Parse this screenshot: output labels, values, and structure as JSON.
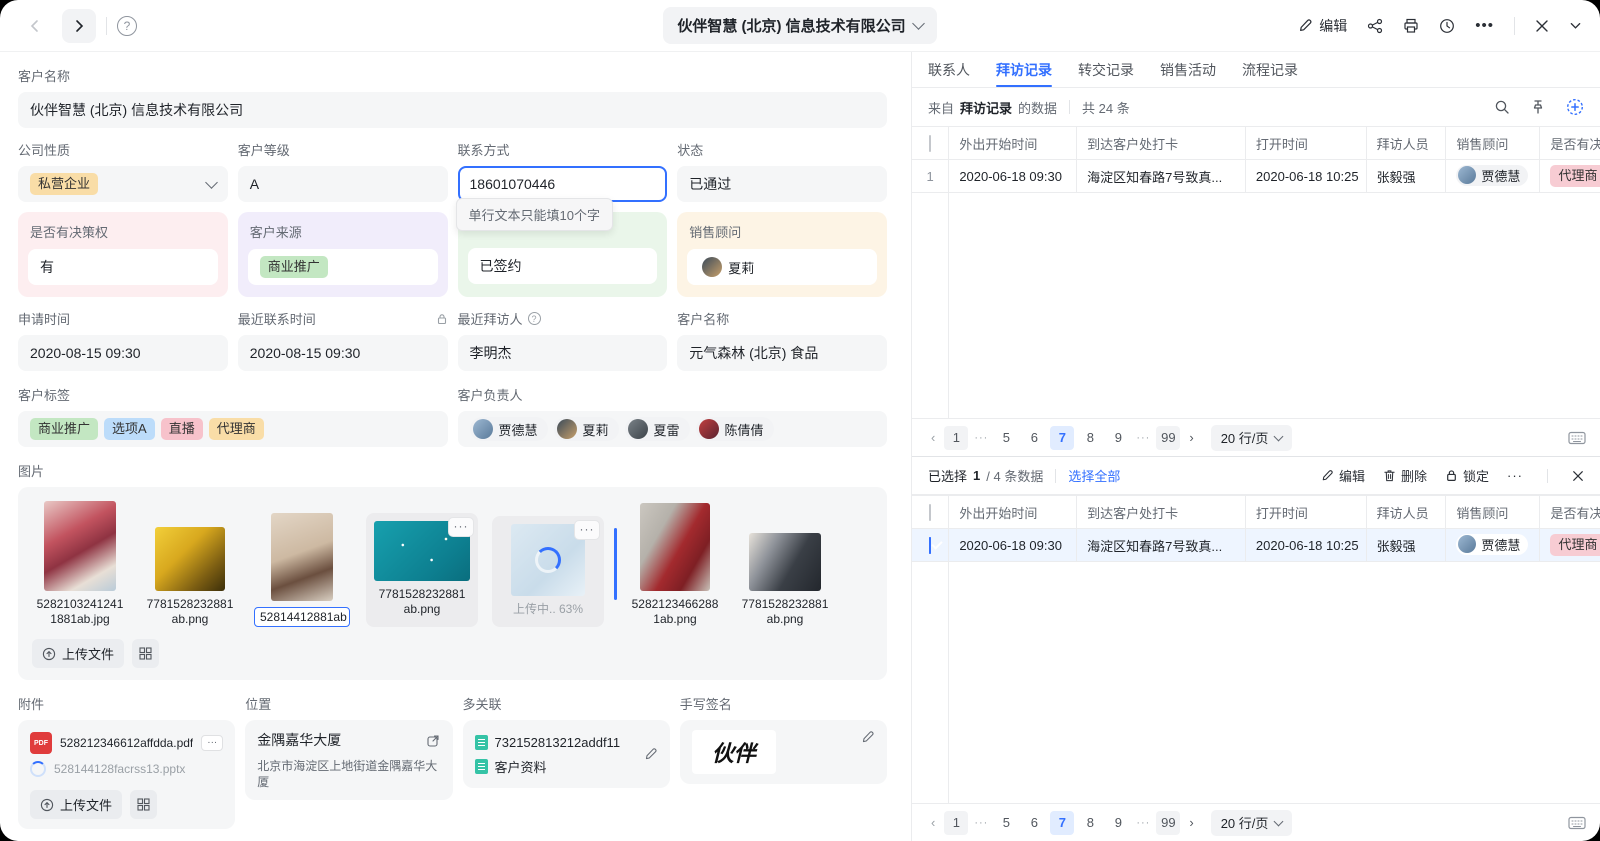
{
  "topbar": {
    "title": "伙伴智慧 (北京) 信息技术有限公司",
    "edit_label": "编辑"
  },
  "form": {
    "customer_name": {
      "label": "客户名称",
      "value": "伙伴智慧 (北京) 信息技术有限公司"
    },
    "company_type": {
      "label": "公司性质",
      "tag": "私营企业"
    },
    "customer_level": {
      "label": "客户等级",
      "value": "A"
    },
    "contact": {
      "label": "联系方式",
      "value": "18601070446",
      "tooltip": "单行文本只能填10个字"
    },
    "status": {
      "label": "状态",
      "value": "已通过"
    },
    "decision": {
      "label": "是否有决策权",
      "value": "有"
    },
    "source": {
      "label": "客户来源",
      "tag": "商业推广"
    },
    "sign_status": {
      "value": "已签约"
    },
    "sales_advisor": {
      "label": "销售顾问",
      "person": "夏莉"
    },
    "apply_time": {
      "label": "申请时间",
      "value": "2020-08-15 09:30"
    },
    "last_contact_time": {
      "label": "最近联系时间",
      "value": "2020-08-15 09:30"
    },
    "last_visitor": {
      "label": "最近拜访人",
      "value": "李明杰",
      "info": "?"
    },
    "customer_name2": {
      "label": "客户名称",
      "value": "元气森林 (北京) 食品"
    },
    "tags": {
      "label": "客户标签",
      "items": [
        "商业推广",
        "选项A",
        "直播",
        "代理商"
      ]
    },
    "owners": {
      "label": "客户负责人",
      "people": [
        "贾德慧",
        "夏莉",
        "夏雷",
        "陈倩倩"
      ]
    }
  },
  "images": {
    "label": "图片",
    "items": [
      {
        "caption1": "5282103241241",
        "caption2": "1881ab.jpg"
      },
      {
        "caption1": "7781528232881",
        "caption2": "ab.png"
      },
      {
        "rename_value": "52814412881ab"
      },
      {
        "caption1": "7781528232881",
        "caption2": "ab.png",
        "menu": "···"
      },
      {
        "status": "上传中.. 63%",
        "menu": "···"
      },
      {
        "caption1": "5282123466288",
        "caption2": "1ab.png"
      },
      {
        "caption1": "7781528232881",
        "caption2": "ab.png"
      }
    ],
    "upload_label": "上传文件"
  },
  "attachments": {
    "label": "附件",
    "files": [
      {
        "name": "528212346612affdda.pdf",
        "badge": "PDF",
        "menu": "···"
      },
      {
        "name": "528144128facrss13.pptx"
      }
    ],
    "upload_label": "上传文件"
  },
  "location": {
    "label": "位置",
    "name": "金隅嘉华大厦",
    "address": "北京市海淀区上地街道金隅嘉华大厦"
  },
  "relations": {
    "label": "多关联",
    "items": [
      "732152813212addf11",
      "客户资料"
    ]
  },
  "signature": {
    "label": "手写签名",
    "value": "伙伴"
  },
  "right": {
    "tabs": [
      "联系人",
      "拜访记录",
      "转交记录",
      "销售活动",
      "流程记录"
    ],
    "info": {
      "prefix": "来自",
      "source": "拜访记录",
      "suffix": "的数据",
      "count": "共 24 条"
    },
    "columns": [
      "外出开始时间",
      "到达客户处打卡",
      "打开时间",
      "拜访人员",
      "销售顾问",
      "是否有决策权"
    ],
    "row": {
      "num": "1",
      "start_time": "2020-06-18 09:30",
      "checkin": "海淀区知春路7号致真...",
      "open_time": "2020-06-18 10:25",
      "visitor": "张毅强",
      "advisor": "贾德慧",
      "decision": "代理商"
    },
    "pagination": {
      "pages": [
        "1",
        "···",
        "5",
        "6",
        "7",
        "8",
        "9",
        "···",
        "99"
      ],
      "page_size": "20 行/页"
    },
    "selection": {
      "prefix": "已选择",
      "selected": "1",
      "total": "/ 4 条数据",
      "select_all": "选择全部",
      "edit": "编辑",
      "delete": "删除",
      "lock": "锁定",
      "more": "···"
    }
  }
}
